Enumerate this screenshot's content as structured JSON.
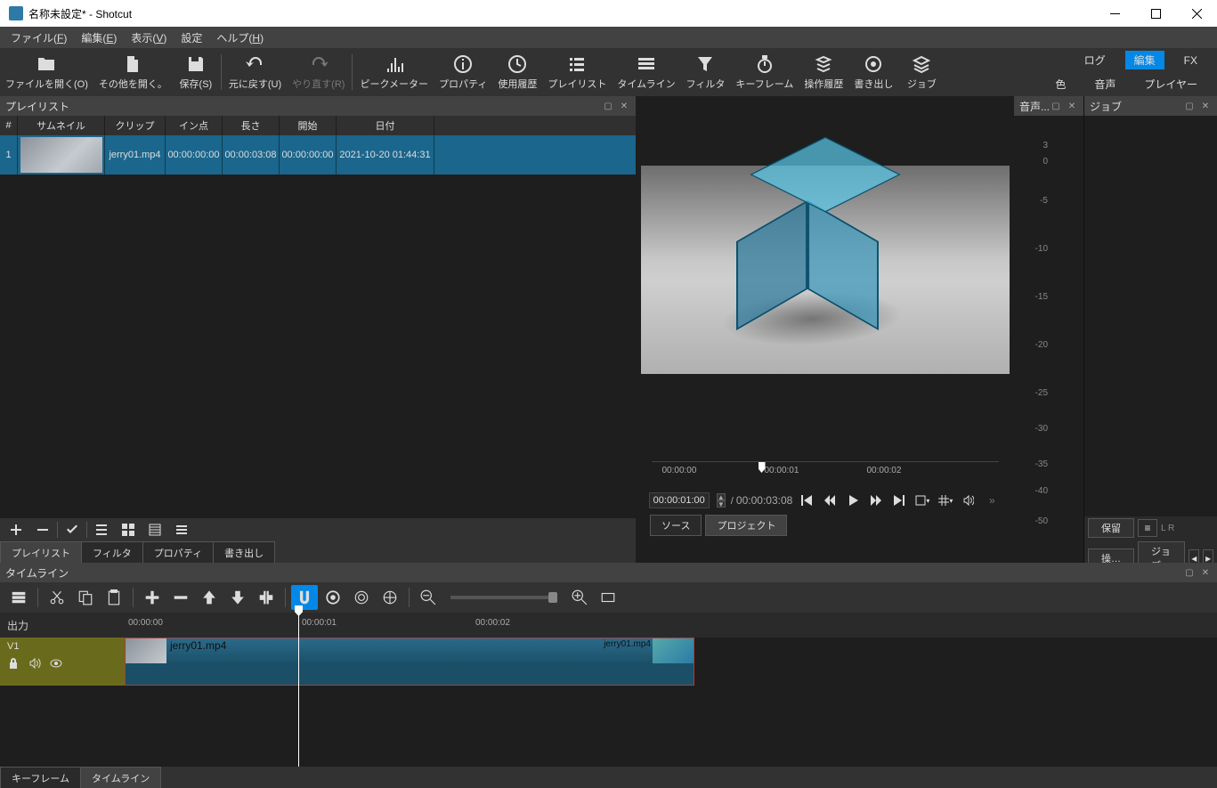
{
  "window": {
    "title": "名称未設定* - Shotcut"
  },
  "menubar": [
    {
      "label": "ファイル",
      "key": "F"
    },
    {
      "label": "編集",
      "key": "E"
    },
    {
      "label": "表示",
      "key": "V"
    },
    {
      "label": "設定",
      "key": ""
    },
    {
      "label": "ヘルプ",
      "key": "H"
    }
  ],
  "toolbar": [
    {
      "name": "open-file",
      "label": "ファイルを開く(O)",
      "icon": "folder"
    },
    {
      "name": "open-other",
      "label": "その他を開く。",
      "icon": "file"
    },
    {
      "name": "save",
      "label": "保存(S)",
      "icon": "save"
    },
    {
      "sep": true
    },
    {
      "name": "undo",
      "label": "元に戻す(U)",
      "icon": "undo"
    },
    {
      "name": "redo",
      "label": "やり直す(R)",
      "icon": "redo",
      "disabled": true
    },
    {
      "sep": true
    },
    {
      "name": "peak-meter",
      "label": "ピークメーター",
      "icon": "bars"
    },
    {
      "name": "properties",
      "label": "プロパティ",
      "icon": "info"
    },
    {
      "name": "history",
      "label": "使用履歴",
      "icon": "clock"
    },
    {
      "name": "playlist",
      "label": "プレイリスト",
      "icon": "list"
    },
    {
      "name": "timeline",
      "label": "タイムライン",
      "icon": "timeline"
    },
    {
      "name": "filters",
      "label": "フィルタ",
      "icon": "funnel"
    },
    {
      "name": "keyframes",
      "label": "キーフレーム",
      "icon": "stopwatch"
    },
    {
      "name": "op-history",
      "label": "操作履歴",
      "icon": "stack"
    },
    {
      "name": "export",
      "label": "書き出し",
      "icon": "target"
    },
    {
      "name": "jobs",
      "label": "ジョブ",
      "icon": "layers"
    }
  ],
  "rtabs": {
    "row1": [
      "ログ",
      "編集",
      "FX"
    ],
    "row1_active": 1,
    "row2": [
      "色",
      "音声",
      "プレイヤー"
    ]
  },
  "playlist": {
    "title": "プレイリスト",
    "columns": [
      "#",
      "サムネイル",
      "クリップ",
      "イン点",
      "長さ",
      "開始",
      "日付"
    ],
    "rows": [
      {
        "num": "1",
        "clip": "jerry01.mp4",
        "in": "00:00:00:00",
        "dur": "00:00:03:08",
        "start": "00:00:00:00",
        "date": "2021-10-20 01:44:31"
      }
    ],
    "bottom_tabs": [
      "プレイリスト",
      "フィルタ",
      "プロパティ",
      "書き出し"
    ],
    "active_tab": 0
  },
  "preview": {
    "audio_title": "音声...",
    "db_labels": [
      "3",
      "0",
      "-5",
      "-10",
      "-15",
      "-20",
      "-25",
      "-30",
      "-35",
      "-40",
      "-50"
    ],
    "scrubber": [
      "00:00:00",
      "00:00:01",
      "00:00:02"
    ],
    "timecode": "00:00:01:00",
    "duration": "00:00:03:08",
    "source_tabs": [
      "ソース",
      "プロジェクト"
    ],
    "active_source": 1
  },
  "jobs": {
    "title": "ジョブ",
    "hold": "保留",
    "lr": "L   R",
    "op": "操…",
    "job": "ジョブ"
  },
  "timeline": {
    "title": "タイムライン",
    "output": "出力",
    "ruler": [
      "00:00:00",
      "00:00:01",
      "00:00:02"
    ],
    "track": {
      "name": "V1",
      "clip": "jerry01.mp4",
      "clip2": "jerry01.mp4"
    },
    "bottom_tabs": [
      "キーフレーム",
      "タイムライン"
    ],
    "active_tab": 1
  }
}
